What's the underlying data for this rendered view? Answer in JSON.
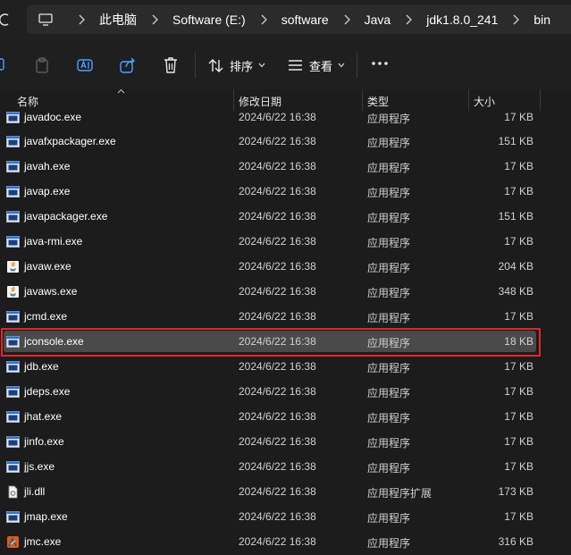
{
  "breadcrumb": [
    "此电脑",
    "Software (E:)",
    "software",
    "Java",
    "jdk1.8.0_241",
    "bin"
  ],
  "toolbar": {
    "sort_label": "排序",
    "view_label": "查看"
  },
  "columns": {
    "name": "名称",
    "modified": "修改日期",
    "type": "类型",
    "size": "大小"
  },
  "files": [
    {
      "name": "javadoc.exe",
      "date": "2024/6/22 16:38",
      "type": "应用程序",
      "size": "17 KB",
      "icon": "exe-icon"
    },
    {
      "name": "javafxpackager.exe",
      "date": "2024/6/22 16:38",
      "type": "应用程序",
      "size": "151 KB",
      "icon": "exe-icon"
    },
    {
      "name": "javah.exe",
      "date": "2024/6/22 16:38",
      "type": "应用程序",
      "size": "17 KB",
      "icon": "exe-icon"
    },
    {
      "name": "javap.exe",
      "date": "2024/6/22 16:38",
      "type": "应用程序",
      "size": "17 KB",
      "icon": "exe-icon"
    },
    {
      "name": "javapackager.exe",
      "date": "2024/6/22 16:38",
      "type": "应用程序",
      "size": "151 KB",
      "icon": "exe-icon"
    },
    {
      "name": "java-rmi.exe",
      "date": "2024/6/22 16:38",
      "type": "应用程序",
      "size": "17 KB",
      "icon": "exe-icon"
    },
    {
      "name": "javaw.exe",
      "date": "2024/6/22 16:38",
      "type": "应用程序",
      "size": "204 KB",
      "icon": "java-cup-icon"
    },
    {
      "name": "javaws.exe",
      "date": "2024/6/22 16:38",
      "type": "应用程序",
      "size": "348 KB",
      "icon": "java-cup-icon"
    },
    {
      "name": "jcmd.exe",
      "date": "2024/6/22 16:38",
      "type": "应用程序",
      "size": "17 KB",
      "icon": "exe-icon"
    },
    {
      "name": "jconsole.exe",
      "date": "2024/6/22 16:38",
      "type": "应用程序",
      "size": "18 KB",
      "icon": "exe-icon",
      "selected": true
    },
    {
      "name": "jdb.exe",
      "date": "2024/6/22 16:38",
      "type": "应用程序",
      "size": "17 KB",
      "icon": "exe-icon"
    },
    {
      "name": "jdeps.exe",
      "date": "2024/6/22 16:38",
      "type": "应用程序",
      "size": "17 KB",
      "icon": "exe-icon"
    },
    {
      "name": "jhat.exe",
      "date": "2024/6/22 16:38",
      "type": "应用程序",
      "size": "17 KB",
      "icon": "exe-icon"
    },
    {
      "name": "jinfo.exe",
      "date": "2024/6/22 16:38",
      "type": "应用程序",
      "size": "17 KB",
      "icon": "exe-icon"
    },
    {
      "name": "jjs.exe",
      "date": "2024/6/22 16:38",
      "type": "应用程序",
      "size": "17 KB",
      "icon": "exe-icon"
    },
    {
      "name": "jli.dll",
      "date": "2024/6/22 16:38",
      "type": "应用程序扩展",
      "size": "173 KB",
      "icon": "dll-icon"
    },
    {
      "name": "jmap.exe",
      "date": "2024/6/22 16:38",
      "type": "应用程序",
      "size": "17 KB",
      "icon": "exe-icon"
    },
    {
      "name": "jmc.exe",
      "date": "2024/6/22 16:38",
      "type": "应用程序",
      "size": "316 KB",
      "icon": "jmc-icon"
    }
  ],
  "colors": {
    "background": "#1c1c1c",
    "selection": "#4a4a4a",
    "highlight_frame": "#e0262b"
  }
}
